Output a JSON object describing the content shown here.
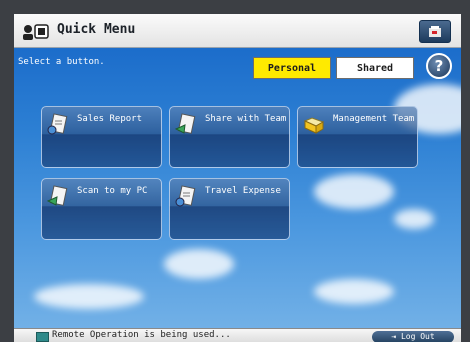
{
  "header": {
    "title": "Quick Menu",
    "settings_icon": "device-settings-icon"
  },
  "instruction": "Select a button.",
  "tabs": [
    {
      "label": "Personal",
      "selected": true
    },
    {
      "label": "Shared",
      "selected": false
    }
  ],
  "help": {
    "label": "?"
  },
  "tiles": [
    {
      "label": "Sales Report",
      "icon": "document-icon"
    },
    {
      "label": "Share with Team",
      "icon": "send-icon"
    },
    {
      "label": "Management Team",
      "icon": "folder-icon"
    },
    {
      "label": "Scan to my PC",
      "icon": "scan-icon"
    },
    {
      "label": "Travel Expense",
      "icon": "document-icon"
    }
  ],
  "status": {
    "text": "Remote Operation is being used...",
    "logout": "Log Out"
  },
  "colors": {
    "tab_selected": "#ffea00",
    "sky_top": "#1565c7",
    "sky_bottom": "#77b4e8"
  }
}
